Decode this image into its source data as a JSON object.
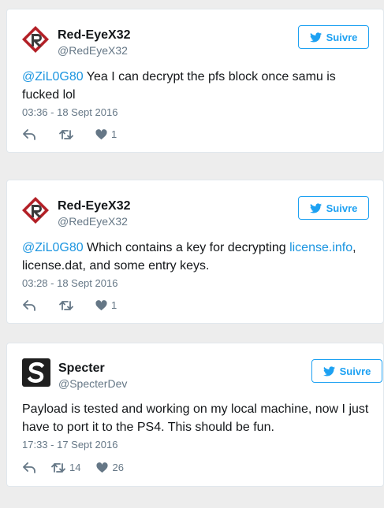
{
  "colors": {
    "background": "#ededed",
    "accent": "#1da1f2",
    "link": "#1b95e0",
    "muted": "#657786",
    "text": "#14171a",
    "redeyex_logo": "#b32027",
    "specter_logo": "#1f1f1f"
  },
  "tweets": [
    {
      "avatar_icon": "red-eye-r-logo-icon",
      "name": "Red-EyeX32",
      "handle": "@RedEyeX32",
      "follow_label": "Suivre",
      "text_parts": {
        "mention": "@ZiL0G80",
        "line1_rest": " Yea I can decrypt the pfs block once samu is",
        "line2": "fucked lol"
      },
      "timestamp": "03:36 - 18 Sept 2016",
      "retweets": "",
      "likes": "1"
    },
    {
      "avatar_icon": "red-eye-r-logo-icon",
      "name": "Red-EyeX32",
      "handle": "@RedEyeX32",
      "follow_label": "Suivre",
      "text_parts": {
        "mention": "@ZiL0G80",
        "line1_mid": " Which contains a key for decrypting ",
        "link": "license.info",
        "line1_end": ",",
        "line2": "license.dat, and some entry keys."
      },
      "timestamp": "03:28 - 18 Sept 2016",
      "retweets": "",
      "likes": "1"
    },
    {
      "avatar_icon": "specter-s-logo-icon",
      "name": "Specter",
      "handle": "@SpecterDev",
      "follow_label": "Suivre",
      "text_parts": {
        "line1": "Payload is tested and working on my local machine, now I just",
        "line2": "have to port it to the PS4. This should be fun."
      },
      "timestamp": "17:33 - 17 Sept 2016",
      "retweets": "14",
      "likes": "26"
    }
  ]
}
